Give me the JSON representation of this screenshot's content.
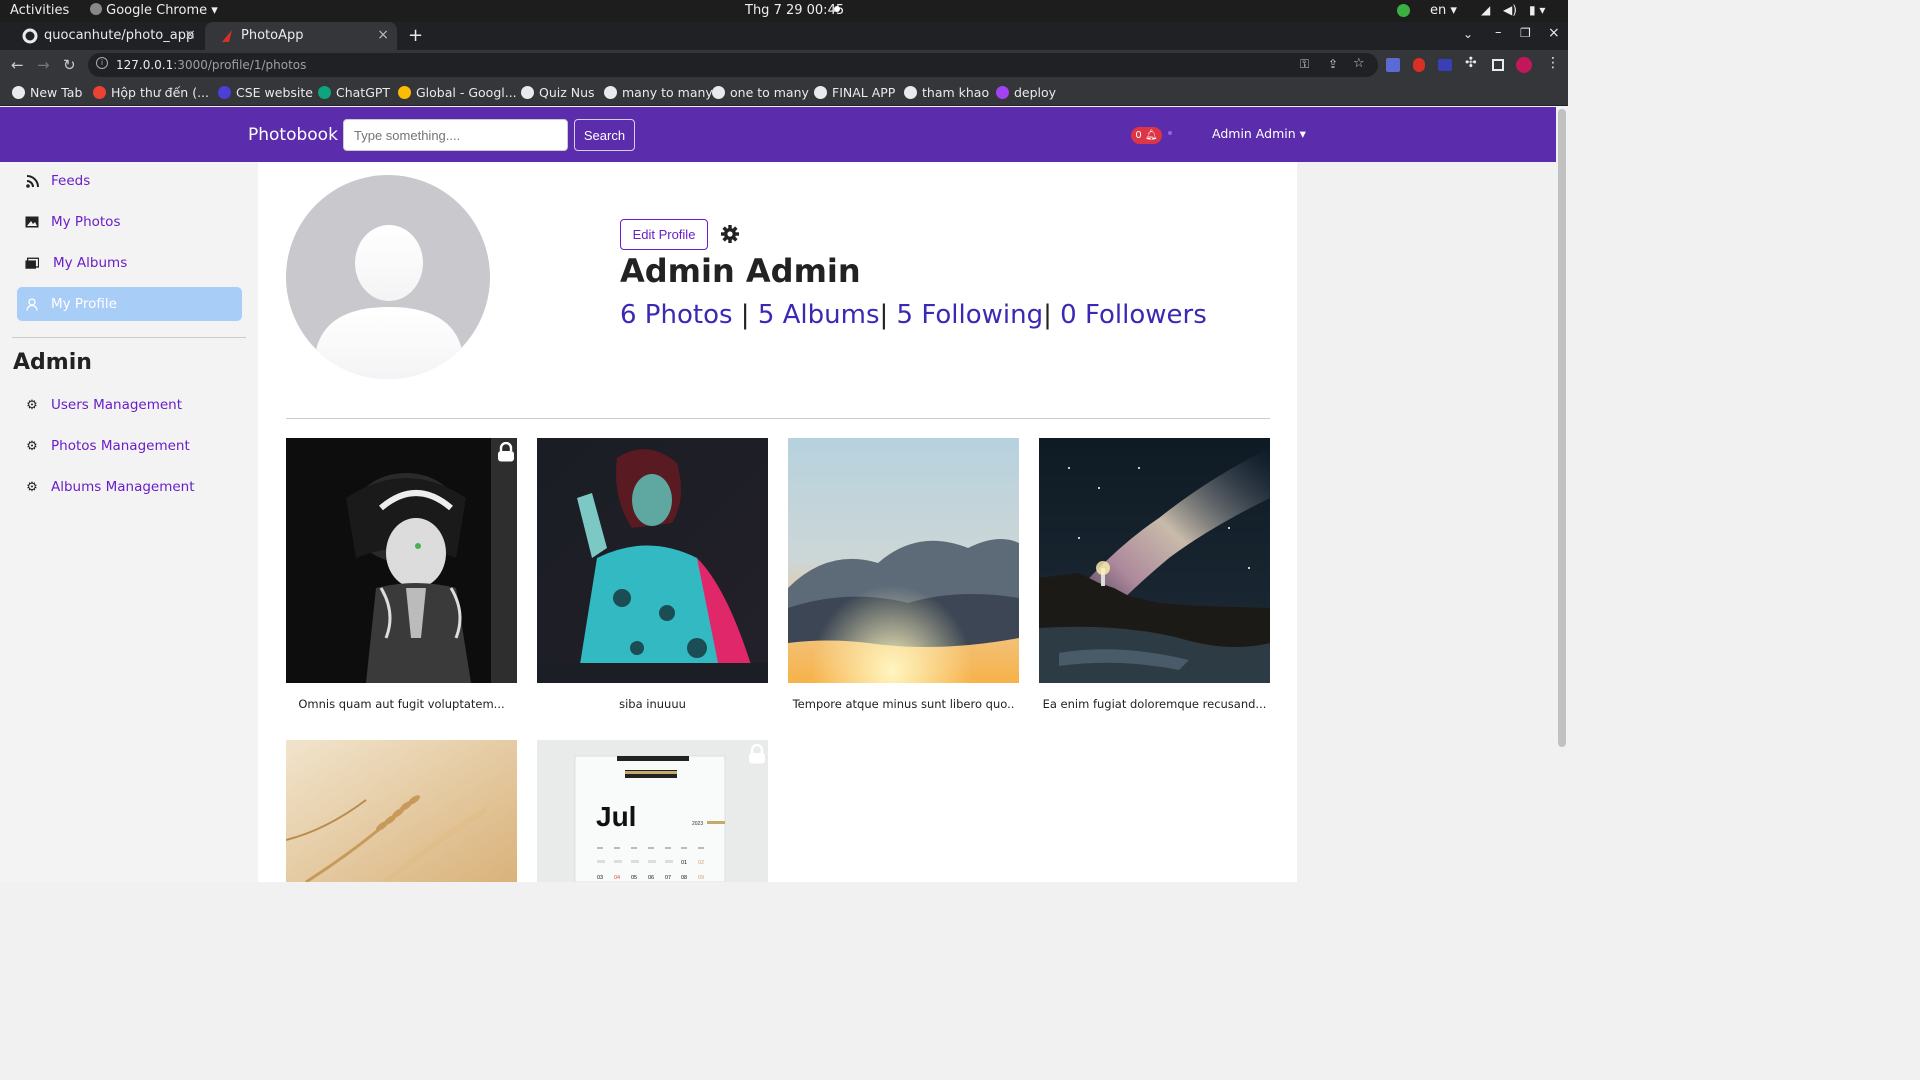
{
  "os": {
    "activities": "Activities",
    "app": "Google Chrome",
    "clock": "Thg 7 29  00:45",
    "lang": "en"
  },
  "tabs": [
    {
      "title": "quocanhute/photo_app"
    },
    {
      "title": "PhotoApp"
    }
  ],
  "address": {
    "host": "127.0.0.1",
    "path": ":3000/profile/1/photos"
  },
  "bookmarks": [
    {
      "label": "New Tab",
      "color": "#e8eaed"
    },
    {
      "label": "Hộp thư đến (...",
      "color": "#ea4335"
    },
    {
      "label": "CSE website",
      "color": "#4b3fd6"
    },
    {
      "label": "ChatGPT",
      "color": "#10a37f"
    },
    {
      "label": "Global - Googl...",
      "color": "#fbbc04"
    },
    {
      "label": "Quiz Nus",
      "color": "#e8eaed"
    },
    {
      "label": "many to many",
      "color": "#e8eaed"
    },
    {
      "label": "one to many",
      "color": "#e8eaed"
    },
    {
      "label": "FINAL APP",
      "color": "#e8eaed"
    },
    {
      "label": "tham khao",
      "color": "#e8eaed"
    },
    {
      "label": "deploy",
      "color": "#a142f4"
    }
  ],
  "header": {
    "brand": "Photobook",
    "search_placeholder": "Type something....",
    "search_label": "Search",
    "notif_count": "0",
    "user": "Admin Admin",
    "color": "#5b2cab"
  },
  "sidebar": {
    "items": [
      {
        "label": "Feeds",
        "icon": "rss-icon"
      },
      {
        "label": "My Photos",
        "icon": "image-icon"
      },
      {
        "label": "My Albums",
        "icon": "images-icon"
      },
      {
        "label": "My Profile",
        "icon": "user-icon",
        "active": true
      }
    ],
    "admin_heading": "Admin",
    "admin_items": [
      {
        "label": "Users Management",
        "icon": "gear-icon"
      },
      {
        "label": "Photos Management",
        "icon": "gear-icon"
      },
      {
        "label": "Albums Management",
        "icon": "gear-icon"
      }
    ]
  },
  "profile": {
    "edit_label": "Edit Profile",
    "name": "Admin Admin",
    "photos": "6 Photos",
    "albums": "5 Albums",
    "following": "5 Following",
    "followers": "0 Followers"
  },
  "photos": [
    {
      "caption": "Omnis quam aut fugit voluptatem...",
      "locked": true,
      "subject": "anime illustration"
    },
    {
      "caption": "siba inuuuu",
      "locked": false,
      "subject": "woman portrait"
    },
    {
      "caption": "Tempore atque minus sunt libero quo..",
      "locked": false,
      "subject": "sunset clouds"
    },
    {
      "caption": "Ea enim fugiat doloremque recusand...",
      "locked": false,
      "subject": "milky way lighthouse"
    },
    {
      "caption": "",
      "locked": false,
      "subject": "wheat"
    },
    {
      "caption": "",
      "locked": true,
      "subject": "calendar"
    }
  ],
  "calendar": {
    "month": "Jul",
    "year": "2023",
    "days_row1": [
      "01",
      "02"
    ],
    "days_row2": [
      "03",
      "04",
      "05",
      "06",
      "07",
      "08",
      "09"
    ]
  }
}
